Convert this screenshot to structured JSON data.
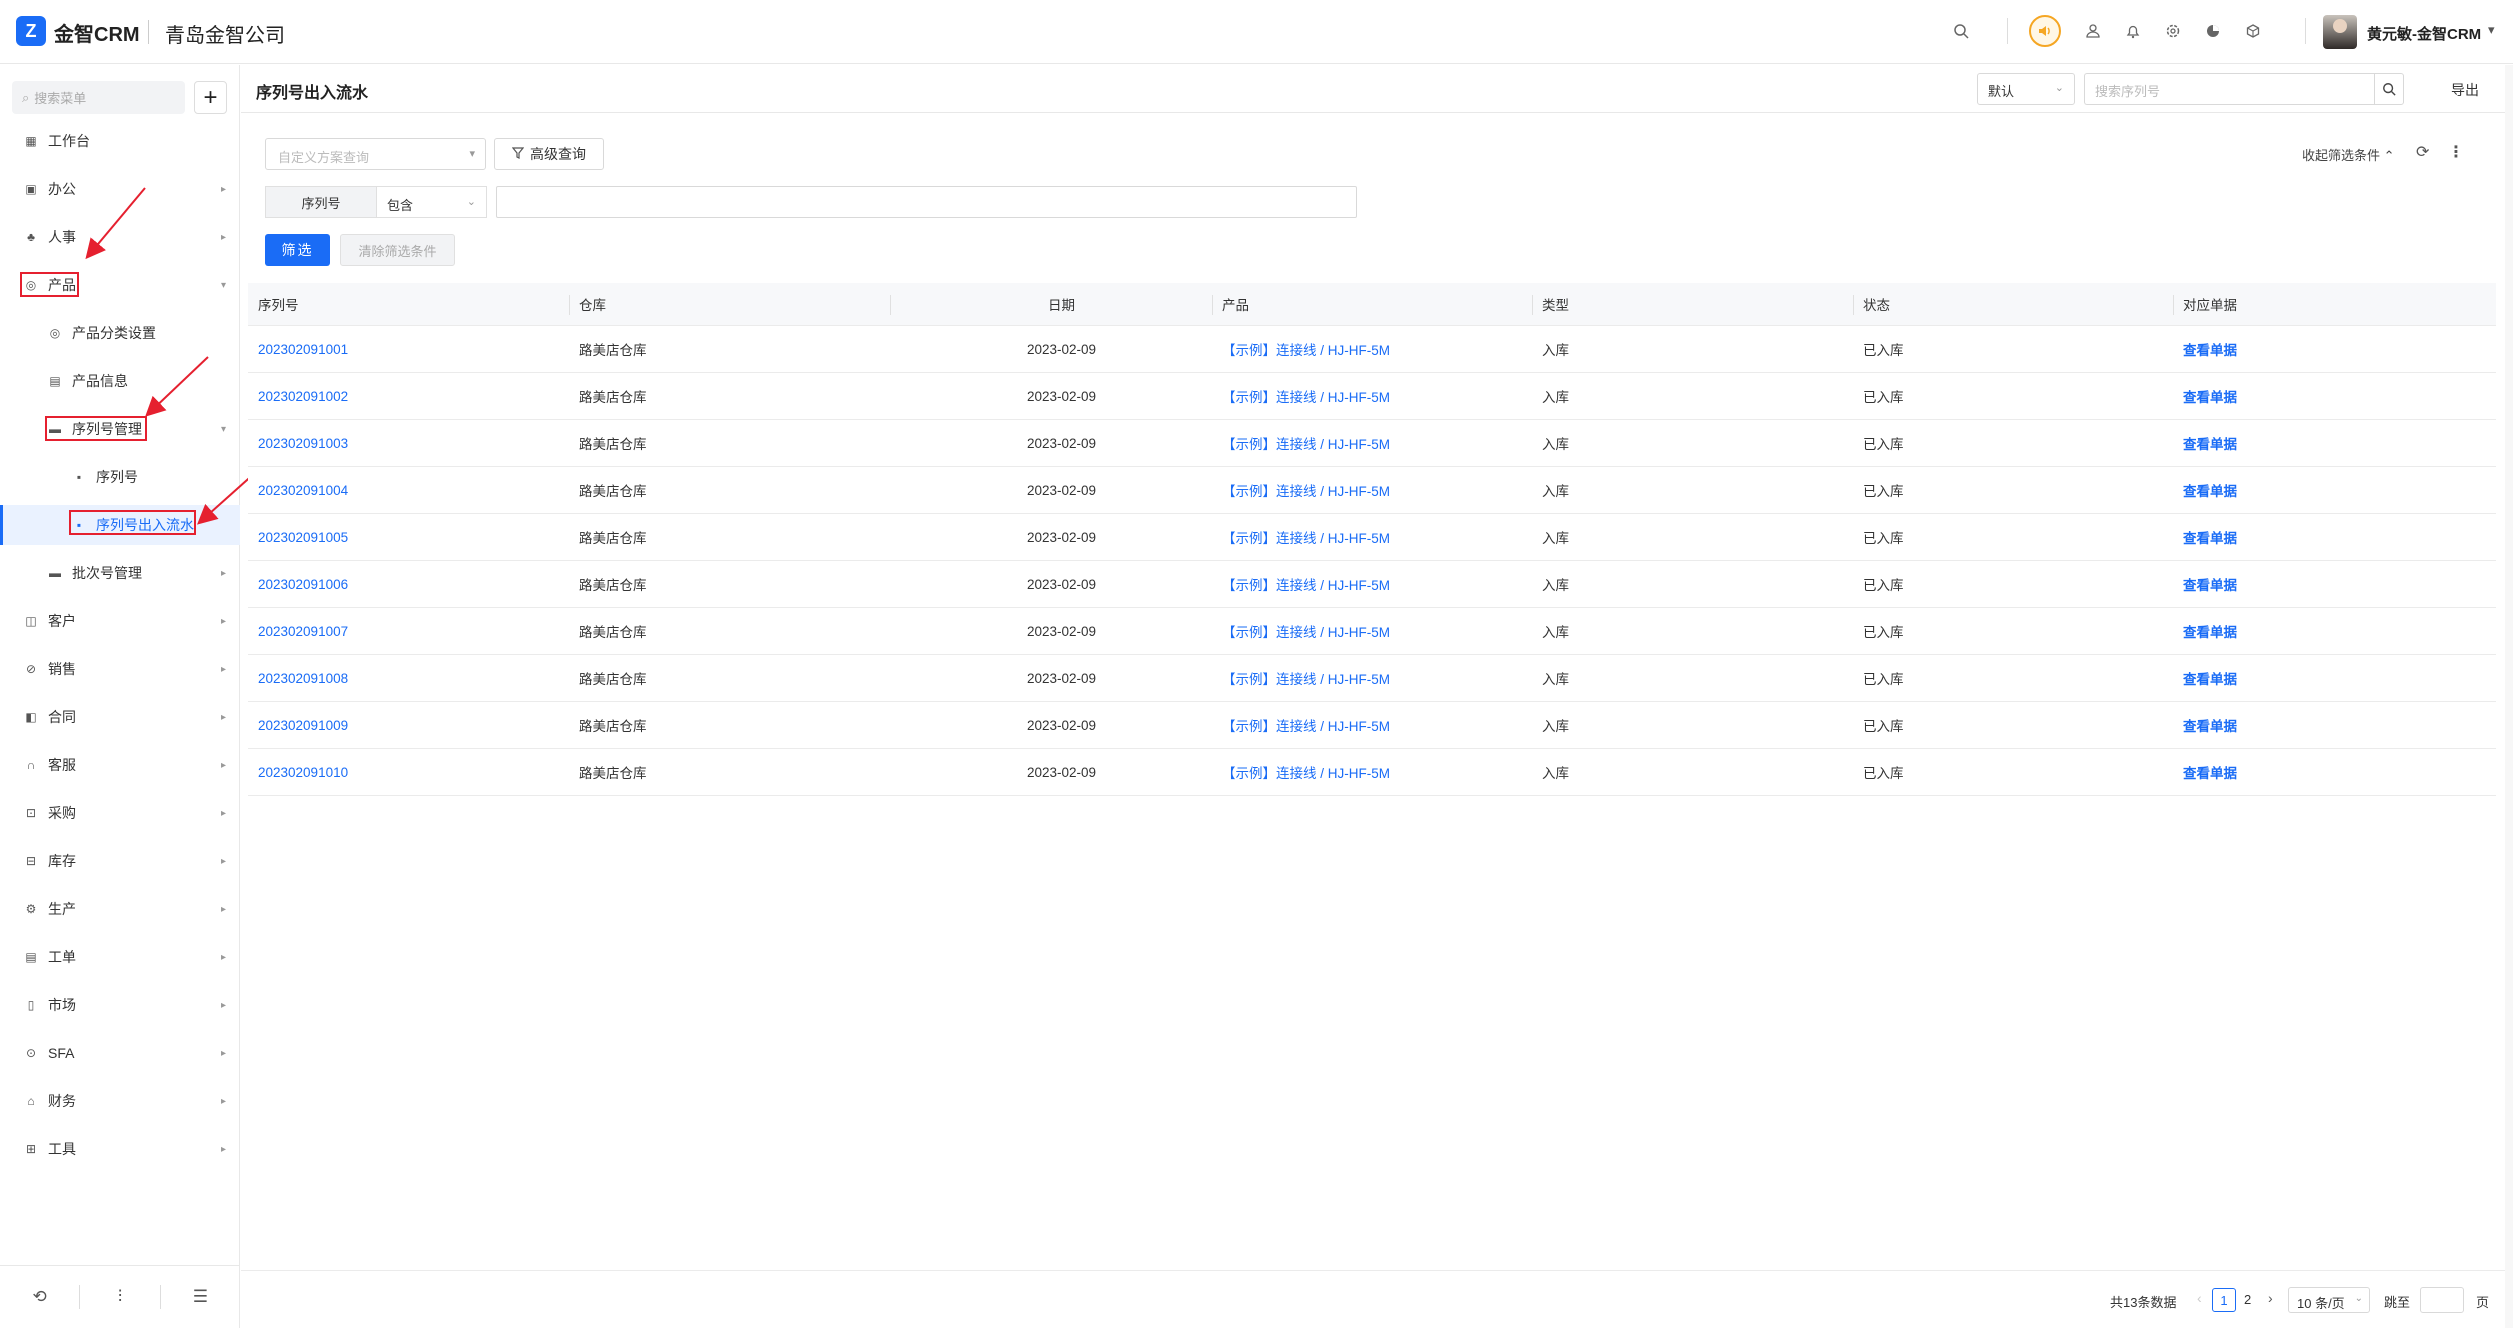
{
  "header": {
    "logo_glyph": "Z",
    "brand": "金智CRM",
    "company": "青岛金智公司",
    "icons": [
      "search-icon",
      "sound-icon",
      "contacts-icon",
      "bell-icon",
      "gear-icon",
      "pie-chart-icon",
      "cube-icon"
    ],
    "username": "黄元敏-金智CRM"
  },
  "sidebar": {
    "search_placeholder": "搜索菜单",
    "items": [
      {
        "label": "工作台",
        "icon": "dashboard-icon"
      },
      {
        "label": "办公",
        "icon": "office-icon"
      },
      {
        "label": "人事",
        "icon": "people-icon"
      },
      {
        "label": "产品",
        "icon": "product-icon"
      },
      {
        "label": "产品分类设置",
        "icon": "category-icon"
      },
      {
        "label": "产品信息",
        "icon": "info-icon"
      },
      {
        "label": "序列号管理",
        "icon": "folder-icon"
      },
      {
        "label": "序列号",
        "icon": "list-icon"
      },
      {
        "label": "序列号出入流水",
        "icon": "list-icon"
      },
      {
        "label": "批次号管理",
        "icon": "folder-icon"
      },
      {
        "label": "客户",
        "icon": "customer-icon"
      },
      {
        "label": "销售",
        "icon": "sales-icon"
      },
      {
        "label": "合同",
        "icon": "contract-icon"
      },
      {
        "label": "客服",
        "icon": "service-icon"
      },
      {
        "label": "采购",
        "icon": "purchase-icon"
      },
      {
        "label": "库存",
        "icon": "inventory-icon"
      },
      {
        "label": "生产",
        "icon": "production-icon"
      },
      {
        "label": "工单",
        "icon": "workorder-icon"
      },
      {
        "label": "市场",
        "icon": "market-icon"
      },
      {
        "label": "SFA",
        "icon": "sfa-icon"
      },
      {
        "label": "财务",
        "icon": "finance-icon"
      },
      {
        "label": "工具",
        "icon": "tools-icon"
      }
    ]
  },
  "page": {
    "title": "序列号出入流水",
    "scheme_default": "默认",
    "search_placeholder": "搜索序列号",
    "export_label": "导出"
  },
  "filters": {
    "scheme_placeholder": "自定义方案查询",
    "advanced_label": "高级查询",
    "collapse_label": "收起筛选条件",
    "field_label": "序列号",
    "operator": "包含",
    "value": "",
    "filter_button": "筛选",
    "clear_button": "清除筛选条件"
  },
  "table": {
    "columns": [
      "序列号",
      "仓库",
      "日期",
      "产品",
      "类型",
      "状态",
      "对应单据"
    ],
    "rows": [
      {
        "serial": "202302091001",
        "warehouse": "路美店仓库",
        "date": "2023-02-09",
        "product": "【示例】连接线 / HJ-HF-5M",
        "type": "入库",
        "status": "已入库",
        "doc": "查看单据"
      },
      {
        "serial": "202302091002",
        "warehouse": "路美店仓库",
        "date": "2023-02-09",
        "product": "【示例】连接线 / HJ-HF-5M",
        "type": "入库",
        "status": "已入库",
        "doc": "查看单据"
      },
      {
        "serial": "202302091003",
        "warehouse": "路美店仓库",
        "date": "2023-02-09",
        "product": "【示例】连接线 / HJ-HF-5M",
        "type": "入库",
        "status": "已入库",
        "doc": "查看单据"
      },
      {
        "serial": "202302091004",
        "warehouse": "路美店仓库",
        "date": "2023-02-09",
        "product": "【示例】连接线 / HJ-HF-5M",
        "type": "入库",
        "status": "已入库",
        "doc": "查看单据"
      },
      {
        "serial": "202302091005",
        "warehouse": "路美店仓库",
        "date": "2023-02-09",
        "product": "【示例】连接线 / HJ-HF-5M",
        "type": "入库",
        "status": "已入库",
        "doc": "查看单据"
      },
      {
        "serial": "202302091006",
        "warehouse": "路美店仓库",
        "date": "2023-02-09",
        "product": "【示例】连接线 / HJ-HF-5M",
        "type": "入库",
        "status": "已入库",
        "doc": "查看单据"
      },
      {
        "serial": "202302091007",
        "warehouse": "路美店仓库",
        "date": "2023-02-09",
        "product": "【示例】连接线 / HJ-HF-5M",
        "type": "入库",
        "status": "已入库",
        "doc": "查看单据"
      },
      {
        "serial": "202302091008",
        "warehouse": "路美店仓库",
        "date": "2023-02-09",
        "product": "【示例】连接线 / HJ-HF-5M",
        "type": "入库",
        "status": "已入库",
        "doc": "查看单据"
      },
      {
        "serial": "202302091009",
        "warehouse": "路美店仓库",
        "date": "2023-02-09",
        "product": "【示例】连接线 / HJ-HF-5M",
        "type": "入库",
        "status": "已入库",
        "doc": "查看单据"
      },
      {
        "serial": "202302091010",
        "warehouse": "路美店仓库",
        "date": "2023-02-09",
        "product": "【示例】连接线 / HJ-HF-5M",
        "type": "入库",
        "status": "已入库",
        "doc": "查看单据"
      }
    ]
  },
  "pagination": {
    "total": "共13条数据",
    "current": "1",
    "next_page": "2",
    "page_size": "10 条/页",
    "jump_label": "跳至",
    "page_suffix": "页"
  },
  "colors": {
    "accent": "#1a6cf6",
    "annotation": "#e5202f",
    "sound_badge": "#f5a623"
  }
}
